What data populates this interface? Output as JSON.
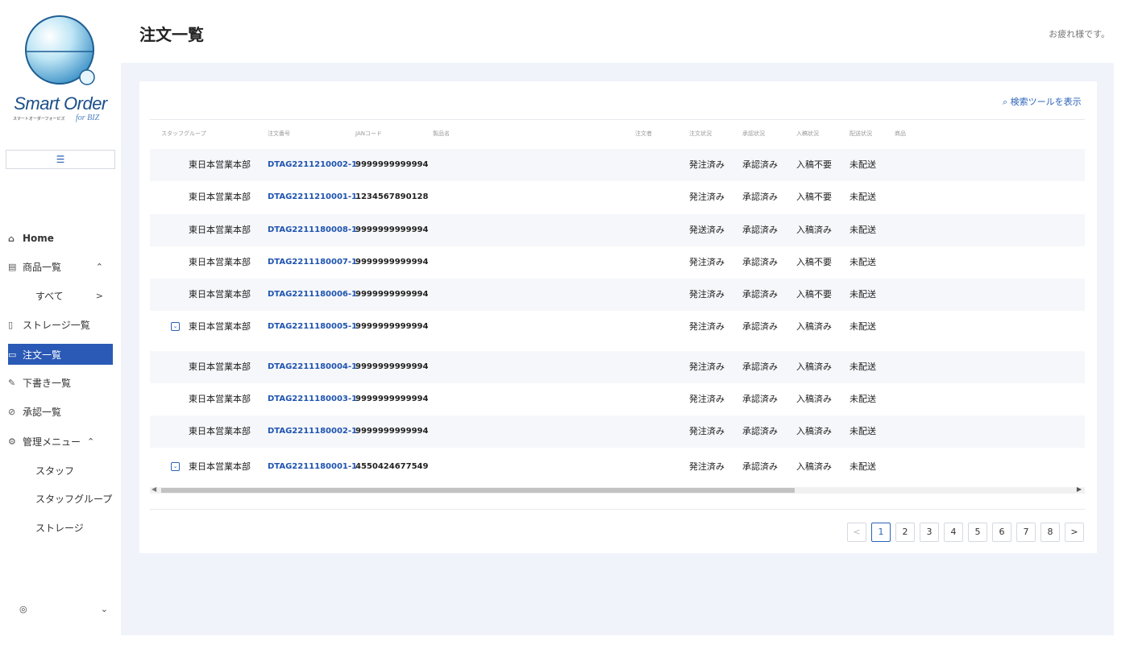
{
  "brand": {
    "title": "Smart Order",
    "subtitle": "スマートオーダーフォービズ",
    "biz": "for BIZ"
  },
  "sidebar": {
    "toggle_icon": "☰",
    "items": [
      {
        "icon": "home-icon",
        "glyph": "⌂",
        "label": "Home"
      },
      {
        "icon": "product-icon",
        "glyph": "▤",
        "label": "商品一覧",
        "right": "⌃"
      },
      {
        "label": "すべて",
        "right": ">"
      },
      {
        "icon": "storage-icon",
        "glyph": "▯",
        "label": "ストレージ一覧"
      },
      {
        "icon": "order-icon",
        "glyph": "▭",
        "label": "注文一覧"
      },
      {
        "icon": "draft-icon",
        "glyph": "✎",
        "label": "下書き一覧"
      },
      {
        "icon": "approval-icon",
        "glyph": "⊘",
        "label": "承認一覧"
      },
      {
        "icon": "admin-icon",
        "glyph": "⚙",
        "label": "管理メニュー",
        "right": "⌃"
      },
      {
        "label": "スタッフ"
      },
      {
        "label": "スタッフグループ"
      },
      {
        "label": "ストレージ"
      }
    ],
    "user": {
      "glyph": "◎",
      "caret": "⌄"
    }
  },
  "header": {
    "title": "注文一覧",
    "greeting": "お疲れ様です。"
  },
  "tools": {
    "search_label": "検索ツールを表示"
  },
  "table": {
    "headers": [
      "スタッフグループ",
      "注文番号",
      "JANコード",
      "製品名",
      "注文者",
      "注文状況",
      "承認状況",
      "入稿状況",
      "配送状況",
      "商品"
    ],
    "rows": [
      {
        "group": "東日本営業本部",
        "order": "DTAG2211210002-1",
        "jan": "9999999999994",
        "order_status": "発注済み",
        "approval": "承認済み",
        "submission": "入稿不要",
        "delivery": "未配送",
        "expand": false
      },
      {
        "group": "東日本営業本部",
        "order": "DTAG2211210001-1",
        "jan": "1234567890128",
        "order_status": "発注済み",
        "approval": "承認済み",
        "submission": "入稿不要",
        "delivery": "未配送",
        "expand": false
      },
      {
        "group": "東日本営業本部",
        "order": "DTAG2211180008-1",
        "jan": "9999999999994",
        "order_status": "発送済み",
        "approval": "承認済み",
        "submission": "入稿済み",
        "delivery": "未配送",
        "expand": false
      },
      {
        "group": "東日本営業本部",
        "order": "DTAG2211180007-1",
        "jan": "9999999999994",
        "order_status": "発注済み",
        "approval": "承認済み",
        "submission": "入稿不要",
        "delivery": "未配送",
        "expand": false
      },
      {
        "group": "東日本営業本部",
        "order": "DTAG2211180006-1",
        "jan": "9999999999994",
        "order_status": "発注済み",
        "approval": "承認済み",
        "submission": "入稿不要",
        "delivery": "未配送",
        "expand": false
      },
      {
        "group": "東日本営業本部",
        "order": "DTAG2211180005-1",
        "jan": "9999999999994",
        "order_status": "発注済み",
        "approval": "承認済み",
        "submission": "入稿済み",
        "delivery": "未配送",
        "expand": true
      },
      {
        "group": "東日本営業本部",
        "order": "DTAG2211180004-1",
        "jan": "9999999999994",
        "order_status": "発注済み",
        "approval": "承認済み",
        "submission": "入稿済み",
        "delivery": "未配送",
        "expand": false
      },
      {
        "group": "東日本営業本部",
        "order": "DTAG2211180003-1",
        "jan": "9999999999994",
        "order_status": "発注済み",
        "approval": "承認済み",
        "submission": "入稿済み",
        "delivery": "未配送",
        "expand": false
      },
      {
        "group": "東日本営業本部",
        "order": "DTAG2211180002-1",
        "jan": "9999999999994",
        "order_status": "発注済み",
        "approval": "承認済み",
        "submission": "入稿済み",
        "delivery": "未配送",
        "expand": false
      },
      {
        "group": "東日本営業本部",
        "order": "DTAG2211180001-1",
        "jan": "4550424677549",
        "order_status": "発注済み",
        "approval": "承認済み",
        "submission": "入稿済み",
        "delivery": "未配送",
        "expand": true
      }
    ]
  },
  "pagination": {
    "prev": "<",
    "next": ">",
    "pages": [
      "1",
      "2",
      "3",
      "4",
      "5",
      "6",
      "7",
      "8"
    ],
    "current": "1"
  },
  "colors": {
    "accent": "#2a5ab5",
    "link": "#1f54b0",
    "main_bg": "#f0f3fa"
  }
}
